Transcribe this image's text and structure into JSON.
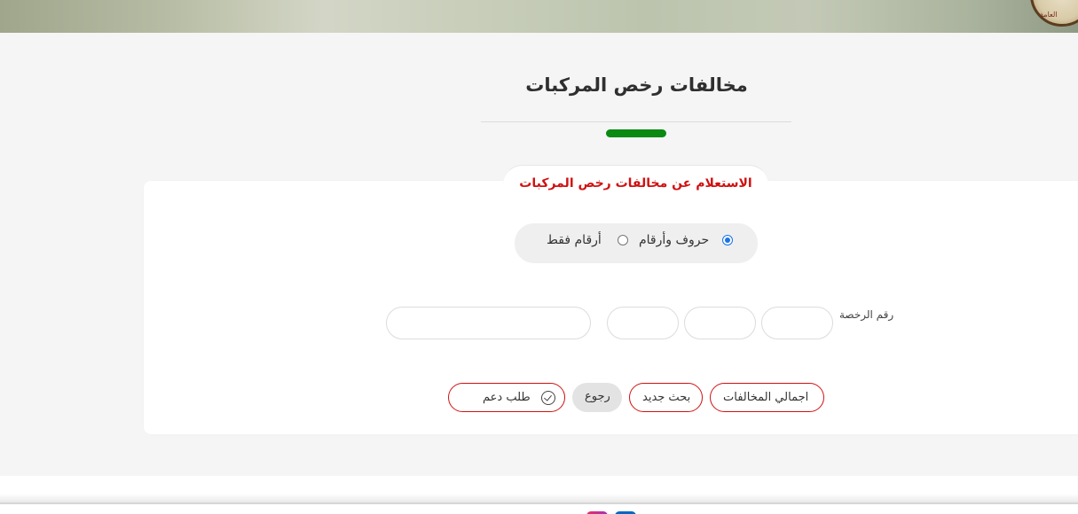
{
  "header": {
    "logo_text": "العامة"
  },
  "page": {
    "title": "مخالفات رخص المركبات"
  },
  "card": {
    "tab_label": "الاستعلام عن مخالفات رخص المركبات"
  },
  "search_type": {
    "options": [
      {
        "label": "حروف وأرقام",
        "selected": true
      },
      {
        "label": "أرقام فقط",
        "selected": false
      }
    ]
  },
  "plate": {
    "label": "رقم الرخصة",
    "letter_1": "",
    "letter_2": "",
    "letter_3": "",
    "numbers": ""
  },
  "actions": {
    "total_violations": "اجمالي المخالفات",
    "new_search": "بحث جديد",
    "back": "رجوع",
    "support_request": "طلب دعم"
  },
  "footer": {
    "social_icons": [
      "instagram-icon",
      "linkedin-icon"
    ]
  },
  "colors": {
    "accent_red": "#d01111",
    "accent_green": "#0a8a12",
    "radio_blue": "#1a73e8"
  }
}
